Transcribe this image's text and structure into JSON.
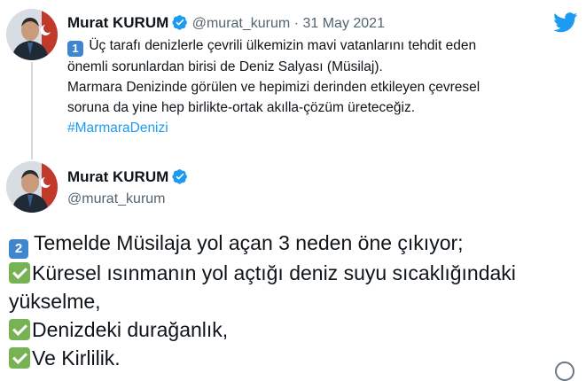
{
  "tweet1": {
    "name": "Murat KURUM",
    "handle": "@murat_kurum",
    "separator": "·",
    "date": "31 May 2021",
    "keycap": "1",
    "line1": "Üç tarafı denizlerle çevrili ülkemizin mavi vatanlarını tehdit eden",
    "line2": "önemli sorunlardan birisi de Deniz Salyası (Müsilaj).",
    "line3": "Marmara Denizinde görülen ve hepimizi derinden etkileyen çevresel",
    "line4": "soruna da yine hep birlikte-ortak akılla-çözüm üreteceğiz.",
    "hashtag": "#MarmaraDenizi"
  },
  "tweet2": {
    "name": "Murat KURUM",
    "handle": "@murat_kurum",
    "keycap": "2",
    "line1": "Temelde Müsilaja yol açan 3 neden öne çıkıyor;",
    "item1a": "Küresel ısınmanın yol açtığı deniz suyu sıcaklığındaki",
    "item1b": "yükselme,",
    "item2": "Denizdeki durağanlık,",
    "item3": "Ve Kirlilik."
  },
  "icons": {
    "brand": "twitter-bird-icon",
    "verified": "verified-badge-icon",
    "check": "white-check-mark-icon"
  },
  "colors": {
    "twitter_blue": "#1d9bf0",
    "keycap_blue": "#3f86cf",
    "check_green": "#77b255",
    "text_gray": "#536471"
  }
}
